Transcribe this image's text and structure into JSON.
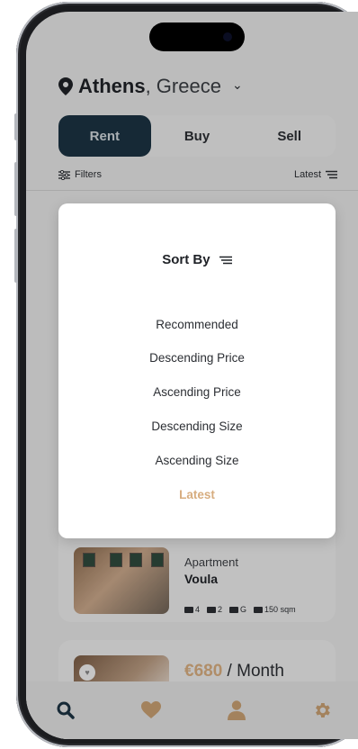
{
  "location": {
    "city": "Athens",
    "country": ", Greece"
  },
  "tabs": [
    {
      "label": "Rent",
      "active": true
    },
    {
      "label": "Buy",
      "active": false
    },
    {
      "label": "Sell",
      "active": false
    }
  ],
  "toolbar": {
    "filters_label": "Filters",
    "sort_label": "Latest"
  },
  "sort_modal": {
    "title": "Sort By",
    "options": [
      {
        "label": "Recommended",
        "selected": false
      },
      {
        "label": "Descending Price",
        "selected": false
      },
      {
        "label": "Ascending Price",
        "selected": false
      },
      {
        "label": "Descending Size",
        "selected": false
      },
      {
        "label": "Ascending Size",
        "selected": false
      },
      {
        "label": "Latest",
        "selected": true
      }
    ]
  },
  "listings": [
    {
      "type": "Apartment",
      "name": "Voula",
      "features": {
        "bedrooms": "4",
        "bathrooms": "2",
        "floor": "G",
        "size": "150 sqm"
      }
    },
    {
      "price_amount": "€680",
      "price_period": " / Month"
    }
  ],
  "nav": [
    {
      "icon": "search-icon"
    },
    {
      "icon": "heart-icon"
    },
    {
      "icon": "profile-icon"
    },
    {
      "icon": "settings-icon"
    }
  ],
  "colors": {
    "accent": "#d7ad7f",
    "navy": "#1c3342",
    "icon_gray": "#6b6b6b"
  }
}
